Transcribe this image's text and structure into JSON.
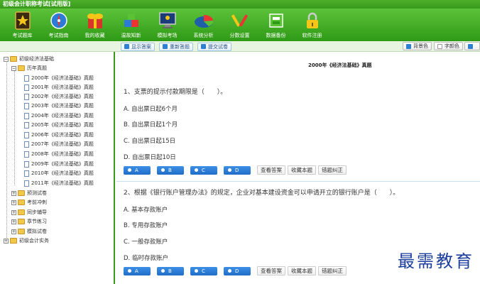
{
  "window": {
    "title": "初级会计职称考试[试用版]"
  },
  "toolbar": [
    {
      "label": "考试题库",
      "icon": "book-star-icon"
    },
    {
      "label": "考试指南",
      "icon": "compass-icon"
    },
    {
      "label": "我的收藏",
      "icon": "gift-icon"
    },
    {
      "label": "温故知新",
      "icon": "blocks-icon"
    },
    {
      "label": "模拟考场",
      "icon": "monitor-icon"
    },
    {
      "label": "系统分析",
      "icon": "pie-chart-icon"
    },
    {
      "label": "分数设置",
      "icon": "tools-icon"
    },
    {
      "label": "数据备份",
      "icon": "database-icon"
    },
    {
      "label": "软件注册",
      "icon": "lock-icon"
    }
  ],
  "content_toolbar": {
    "show_answer": "显示答案",
    "redo": "重新答题",
    "submit": "提交试卷",
    "bg_color": "背景色",
    "font_color": "字颜色",
    "extra": "auto"
  },
  "tree": {
    "root1": "初级经济法基础",
    "group": "历年真题",
    "years": [
      "2000年《经济法基础》真题",
      "2001年《经济法基础》真题",
      "2002年《经济法基础》真题",
      "2003年《经济法基础》真题",
      "2004年《经济法基础》真题",
      "2005年《经济法基础》真题",
      "2006年《经济法基础》真题",
      "2007年《经济法基础》真题",
      "2008年《经济法基础》真题",
      "2009年《经济法基础》真题",
      "2010年《经济法基础》真题",
      "2011年《经济法基础》真题"
    ],
    "others": [
      "预测试卷",
      "考前冲刺",
      "同步辅导",
      "章节练习",
      "模拟试卷"
    ],
    "root2": "初级会计实务"
  },
  "paper": {
    "title": "2000年《经济法基础》真题",
    "questions": [
      {
        "text": "1、支票的提示付款期限是（　　）。",
        "options": [
          "A. 自出票日起6个月",
          "B. 自出票日起1个月",
          "C. 自出票日起15日",
          "D. 自出票日起10日"
        ]
      },
      {
        "text": "2、根据《银行账户管理办法》的规定，企业对基本建设资金可以申请开立的银行账户是（　　）。",
        "options": [
          "A. 基本存款账户",
          "B. 专用存款账户",
          "C. 一般存款账户",
          "D. 临时存款账户"
        ]
      }
    ],
    "answer_buttons": [
      "A",
      "B",
      "C",
      "D"
    ],
    "actions": [
      "查看答案",
      "收藏本题",
      "错题纠正"
    ]
  },
  "watermark": "最需教育",
  "colors": {
    "toolbar_green": "#3a9a1e",
    "answer_blue": "#2d7fd3"
  }
}
